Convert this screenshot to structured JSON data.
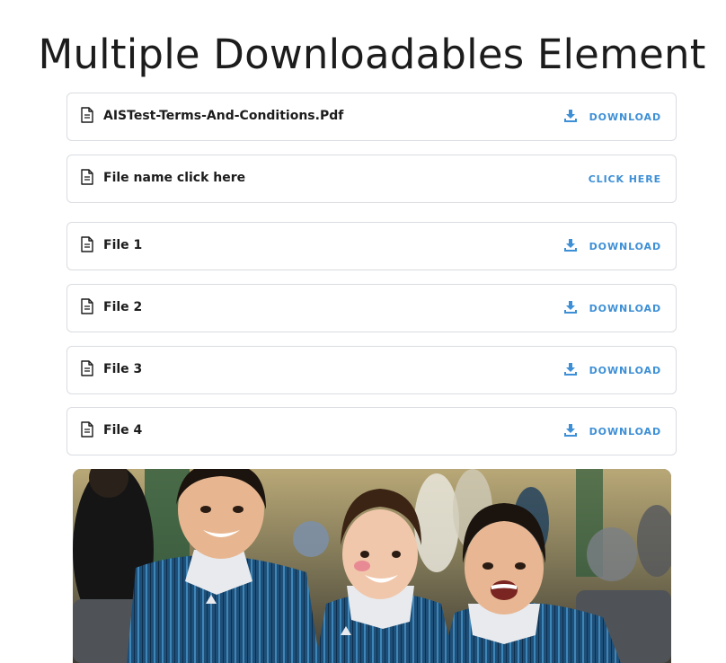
{
  "page": {
    "title": "Multiple Downloadables Element"
  },
  "files": [
    {
      "name": "AISTest-Terms-And-Conditions.Pdf",
      "action": "DOWNLOAD",
      "action_icon": "download-icon"
    },
    {
      "name": "File name click here",
      "action": "CLICK HERE",
      "action_icon": ""
    },
    {
      "name": "File 1",
      "action": "DOWNLOAD",
      "action_icon": "download-icon"
    },
    {
      "name": "File 2",
      "action": "DOWNLOAD",
      "action_icon": "download-icon"
    },
    {
      "name": "File 3",
      "action": "DOWNLOAD",
      "action_icon": "download-icon"
    },
    {
      "name": "File 4",
      "action": "DOWNLOAD",
      "action_icon": "download-icon"
    }
  ],
  "icons": {
    "file": "file-document-icon",
    "download": "download-icon"
  },
  "colors": {
    "accent": "#3d8fd6",
    "border": "#d9dce1",
    "text": "#1c1c1c",
    "uniform_stripe": "#1f5d8a",
    "uniform_collar": "#e8eaee"
  },
  "image": {
    "subject": "three smiling schoolgirls in striped blue uniforms"
  }
}
